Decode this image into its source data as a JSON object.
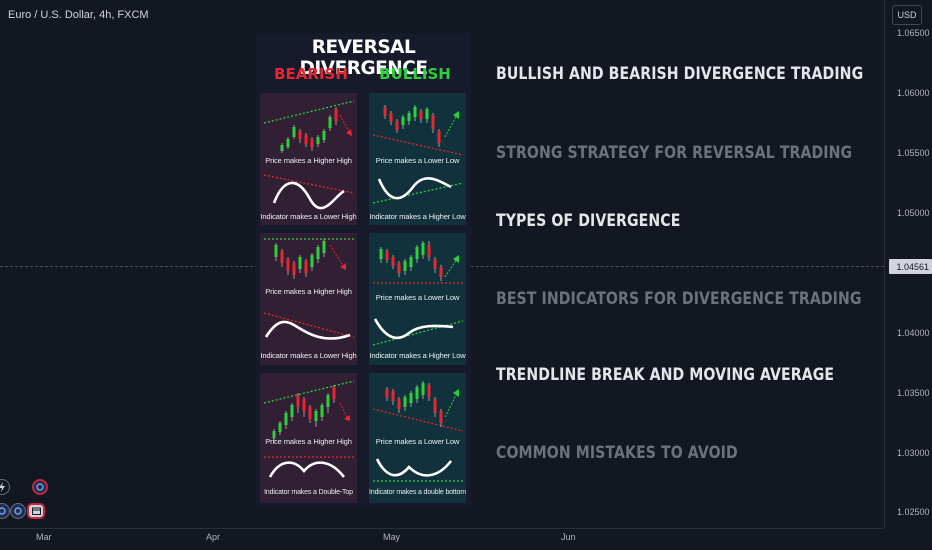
{
  "chart_header": {
    "symbol_title": "Euro / U.S. Dollar, 4h, FXCM"
  },
  "price_axis": {
    "currency": "USD",
    "labels": [
      "1.06500",
      "1.06000",
      "1.05500",
      "1.05000",
      "1.04561",
      "1.04000",
      "1.03500",
      "1.03000",
      "1.02500"
    ],
    "current_price": "1.04561"
  },
  "time_axis": {
    "labels": [
      "Mar",
      "Apr",
      "May",
      "Jun"
    ]
  },
  "infographic": {
    "title": "REVERSAL DIVERGENCE",
    "bearish_label": "BEARISH",
    "bullish_label": "BULLISH",
    "panels": [
      {
        "price_text": "Price makes a Higher High",
        "indicator_text": "Indicator makes a Lower High"
      },
      {
        "price_text": "Price makes a Lower Low",
        "indicator_text": "Indicator makes a Higher Low"
      },
      {
        "price_text": "Price makes a Higher High",
        "indicator_text": "Indicator makes a Lower High"
      },
      {
        "price_text": "Price makes a Lower Low",
        "indicator_text": "Indicator makes a Higher Low"
      },
      {
        "price_text": "Price makes a Higher High",
        "indicator_text": "Indicator makes a Double-Top"
      },
      {
        "price_text": "Price makes a Lower Low",
        "indicator_text": "Indicator makes a double bottom"
      }
    ]
  },
  "headings": [
    "BULLISH AND BEARISH DIVERGENCE TRADING",
    "STRONG STRATEGY FOR REVERSAL TRADING",
    "TYPES OF DIVERGENCE",
    "BEST INDICATORS FOR DIVERGENCE TRADING",
    "TRENDLINE BREAK AND MOVING AVERAGE",
    "COMMON MISTAKES TO AVOID"
  ],
  "colors": {
    "background": "#131722",
    "bearish": "#e8262f",
    "bullish": "#2bd03c",
    "bear_panel": "#311f33",
    "bull_panel": "#11323c"
  },
  "icons": [
    "lightning-icon",
    "magnet-icon",
    "indicator-icon",
    "drawing-icon",
    "calendar-icon"
  ]
}
